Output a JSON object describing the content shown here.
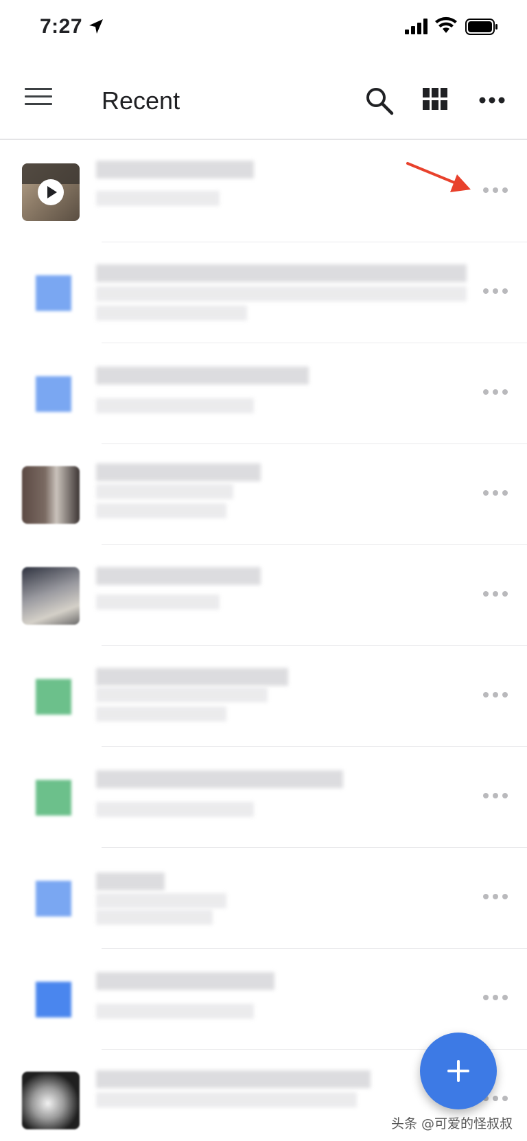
{
  "status_bar": {
    "time": "7:27",
    "icons": [
      "location-arrow-icon",
      "cellular-signal-icon",
      "wifi-icon",
      "battery-icon"
    ]
  },
  "app_bar": {
    "title": "Recent",
    "icons": [
      "menu-icon",
      "search-icon",
      "grid-view-icon",
      "more-options-icon"
    ]
  },
  "files": [
    {
      "kind": "video",
      "icon": "video-thumbnail"
    },
    {
      "kind": "doc",
      "icon": "doc-icon",
      "color": "#4285f4"
    },
    {
      "kind": "doc",
      "icon": "doc-icon",
      "color": "#4285f4"
    },
    {
      "kind": "image",
      "icon": "image-thumbnail"
    },
    {
      "kind": "image",
      "icon": "image-thumbnail"
    },
    {
      "kind": "sheet",
      "icon": "sheet-icon",
      "color": "#34a853"
    },
    {
      "kind": "sheet",
      "icon": "sheet-icon",
      "color": "#34a853"
    },
    {
      "kind": "doc",
      "icon": "doc-icon",
      "color": "#4285f4"
    },
    {
      "kind": "doc",
      "icon": "doc-icon",
      "color": "#1a73e8"
    },
    {
      "kind": "image",
      "icon": "image-thumbnail"
    }
  ],
  "annotation": {
    "color": "#e8412c",
    "icon": "red-arrow-icon"
  },
  "fab": {
    "icon": "plus-icon",
    "color": "#3d7ae5"
  },
  "watermark": "头条 @可爱的怪叔叔"
}
